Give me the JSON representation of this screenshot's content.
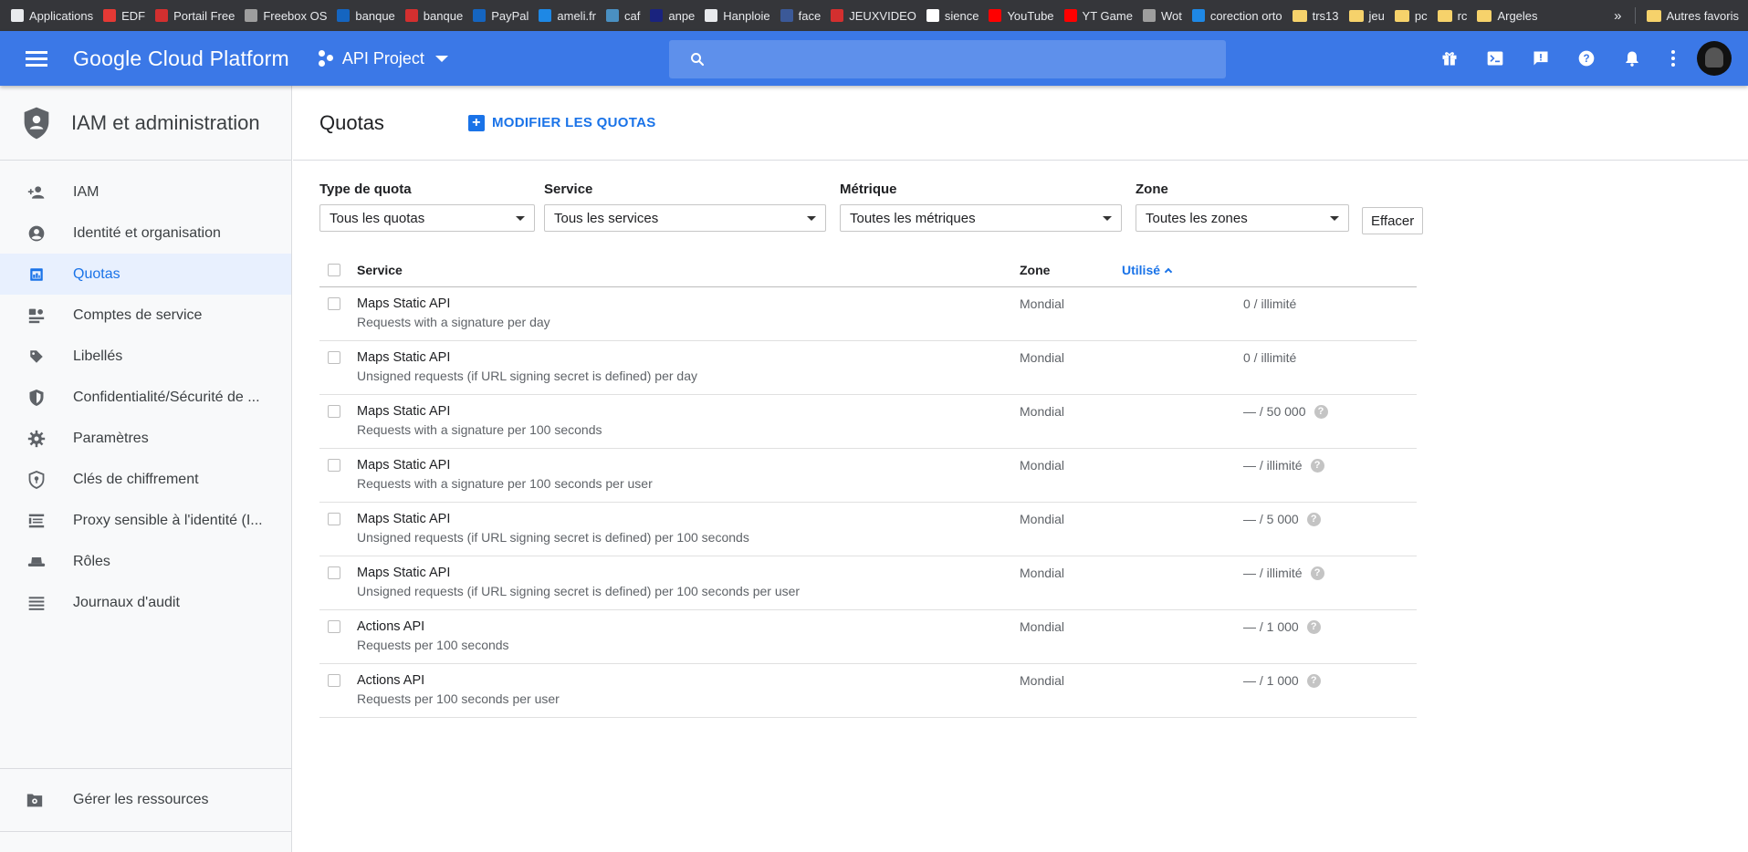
{
  "bookmarks": {
    "items": [
      {
        "label": "Applications",
        "color": "#e8eaed"
      },
      {
        "label": "EDF",
        "color": "#e53935"
      },
      {
        "label": "Portail Free",
        "color": "#d32f2f"
      },
      {
        "label": "Freebox OS",
        "color": "#9e9e9e"
      },
      {
        "label": "banque",
        "color": "#1565c0"
      },
      {
        "label": "banque",
        "color": "#d32f2f"
      },
      {
        "label": "PayPal",
        "color": "#1565c0"
      },
      {
        "label": "ameli.fr",
        "color": "#1e88e5"
      },
      {
        "label": "caf",
        "color": "#4a90c2"
      },
      {
        "label": "anpe",
        "color": "#1a237e"
      },
      {
        "label": "Hanploie",
        "color": "#e8eaed"
      },
      {
        "label": "face",
        "color": "#3b5998"
      },
      {
        "label": "JEUXVIDEO",
        "color": "#d32f2f"
      },
      {
        "label": "sience",
        "color": "#ffffff"
      },
      {
        "label": "YouTube",
        "color": "#ff0000"
      },
      {
        "label": "YT Game",
        "color": "#ff0000"
      },
      {
        "label": "Wot",
        "color": "#9e9e9e"
      },
      {
        "label": "corection orto",
        "color": "#1e88e5"
      }
    ],
    "folders": [
      "trs13",
      "jeu",
      "pc",
      "rc",
      "Argeles"
    ],
    "more": "»",
    "other_favorites": "Autres favoris"
  },
  "header": {
    "title": "Google Cloud Platform",
    "project": "API Project",
    "search_placeholder": ""
  },
  "sidebar": {
    "title": "IAM et administration",
    "items": [
      {
        "label": "IAM",
        "icon": "person-add-icon"
      },
      {
        "label": "Identité et organisation",
        "icon": "account-circle-icon"
      },
      {
        "label": "Quotas",
        "icon": "quota-icon"
      },
      {
        "label": "Comptes de service",
        "icon": "service-account-icon"
      },
      {
        "label": "Libellés",
        "icon": "label-icon"
      },
      {
        "label": "Confidentialité/Sécurité de ...",
        "icon": "security-shield-icon"
      },
      {
        "label": "Paramètres",
        "icon": "settings-gear-icon"
      },
      {
        "label": "Clés de chiffrement",
        "icon": "key-shield-icon"
      },
      {
        "label": "Proxy sensible à l'identité (I...",
        "icon": "proxy-icon"
      },
      {
        "label": "Rôles",
        "icon": "hat-icon"
      },
      {
        "label": "Journaux d'audit",
        "icon": "list-icon"
      }
    ],
    "active_index": 2,
    "bottom_item": "Gérer les ressources"
  },
  "main": {
    "title": "Quotas",
    "edit_button": "MODIFIER LES QUOTAS",
    "filters": [
      {
        "label": "Type de quota",
        "value": "Tous les quotas"
      },
      {
        "label": "Service",
        "value": "Tous les services"
      },
      {
        "label": "Métrique",
        "value": "Toutes les métriques"
      },
      {
        "label": "Zone",
        "value": "Toutes les zones"
      }
    ],
    "clear_button": "Effacer",
    "table": {
      "columns": {
        "service": "Service",
        "zone": "Zone",
        "used": "Utilisé"
      },
      "rows": [
        {
          "service": "Maps Static API",
          "desc": "Requests with a signature per day",
          "zone": "Mondial",
          "value": "0 / illimité",
          "help": false
        },
        {
          "service": "Maps Static API",
          "desc": "Unsigned requests (if URL signing secret is defined) per day",
          "zone": "Mondial",
          "value": "0 / illimité",
          "help": false
        },
        {
          "service": "Maps Static API",
          "desc": "Requests with a signature per 100 seconds",
          "zone": "Mondial",
          "value": "— / 50 000",
          "help": true
        },
        {
          "service": "Maps Static API",
          "desc": "Requests with a signature per 100 seconds per user",
          "zone": "Mondial",
          "value": "— / illimité",
          "help": true
        },
        {
          "service": "Maps Static API",
          "desc": "Unsigned requests (if URL signing secret is defined) per 100 seconds",
          "zone": "Mondial",
          "value": "— / 5 000",
          "help": true
        },
        {
          "service": "Maps Static API",
          "desc": "Unsigned requests (if URL signing secret is defined) per 100 seconds per user",
          "zone": "Mondial",
          "value": "— / illimité",
          "help": true
        },
        {
          "service": "Actions API",
          "desc": "Requests per 100 seconds",
          "zone": "Mondial",
          "value": "— / 1 000",
          "help": true
        },
        {
          "service": "Actions API",
          "desc": "Requests per 100 seconds per user",
          "zone": "Mondial",
          "value": "— / 1 000",
          "help": true
        }
      ]
    }
  },
  "colors": {
    "header": "#3b78e7",
    "accent": "#1a73e8",
    "active_bg": "#e8f0fe"
  }
}
